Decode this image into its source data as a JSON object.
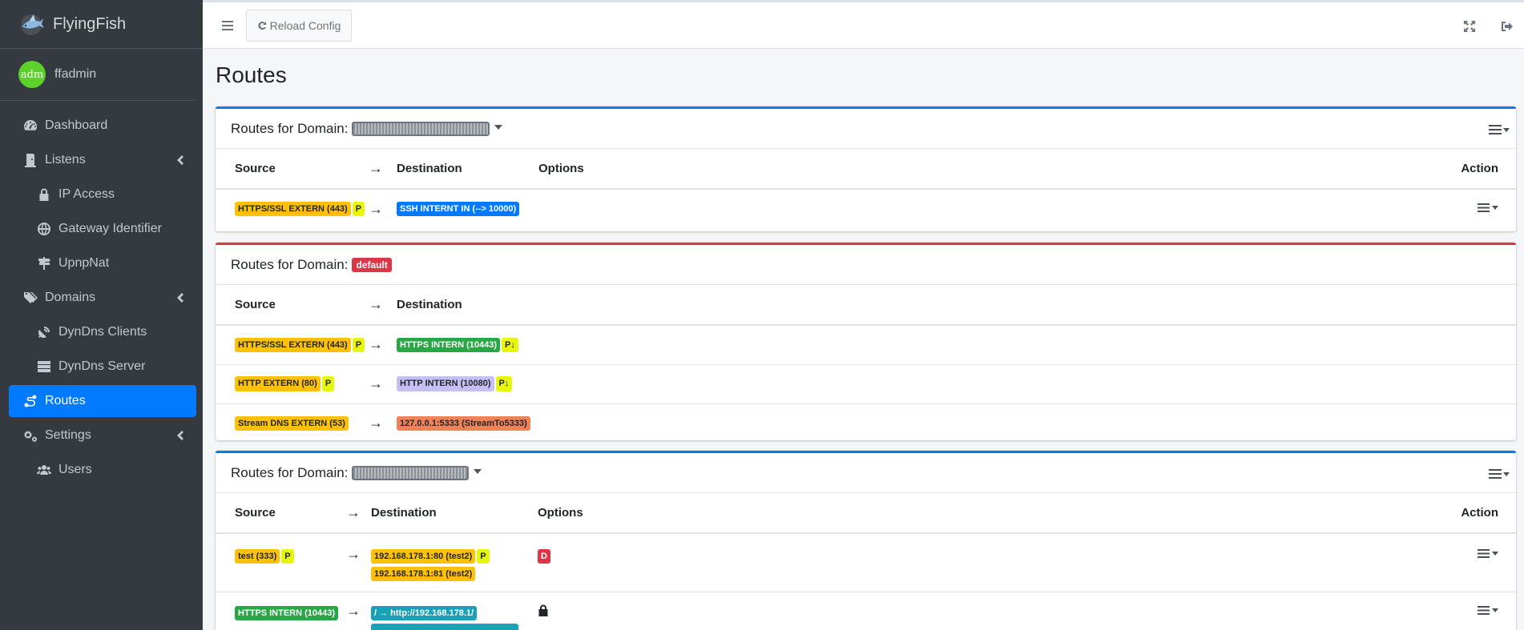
{
  "brand": {
    "name": "FlyingFish"
  },
  "user": {
    "avatar_text": "adm",
    "name": "ffadmin"
  },
  "sidebar": {
    "items": [
      {
        "label": "Dashboard",
        "icon": "tachometer-icon"
      },
      {
        "label": "Listens",
        "icon": "door-icon"
      },
      {
        "label": "IP Access",
        "icon": "lock-icon"
      },
      {
        "label": "Gateway Identifier",
        "icon": "globe-icon"
      },
      {
        "label": "UpnpNat",
        "icon": "signpost-icon"
      },
      {
        "label": "Domains",
        "icon": "tags-icon"
      },
      {
        "label": "DynDns Clients",
        "icon": "satellite-dish-icon"
      },
      {
        "label": "DynDns Server",
        "icon": "server-icon"
      },
      {
        "label": "Routes",
        "icon": "route-icon"
      },
      {
        "label": "Settings",
        "icon": "cogs-icon"
      },
      {
        "label": "Users",
        "icon": "users-icon"
      }
    ]
  },
  "toolbar": {
    "reload_label": "Reload Config"
  },
  "page": {
    "title": "Routes"
  },
  "cards": [
    {
      "header_prefix": "Routes for Domain:",
      "columns": {
        "source": "Source",
        "arrow": "→",
        "destination": "Destination",
        "options": "Options",
        "action": "Action"
      },
      "rows": [
        {
          "source": "HTTPS/SSL EXTERN (443)",
          "source_flag": "P",
          "arrow": "→",
          "destination": "SSH INTERNT IN (--> 10000)"
        }
      ]
    },
    {
      "header_prefix": "Routes for Domain:",
      "domain_badge": "default",
      "columns": {
        "source": "Source",
        "arrow": "→",
        "destination": "Destination"
      },
      "rows": [
        {
          "source": "HTTPS/SSL EXTERN (443)",
          "source_flag": "P",
          "arrow": "→",
          "destination": "HTTPS INTERN (10443)",
          "dest_flag": "P↓"
        },
        {
          "source": "HTTP EXTERN (80)",
          "source_flag": "P",
          "arrow": "→",
          "destination": "HTTP INTERN (10080)",
          "dest_flag": "P↓"
        },
        {
          "source": "Stream DNS EXTERN (53)",
          "arrow": "→",
          "destination": "127.0.0.1:5333 (StreamTo5333)"
        }
      ]
    },
    {
      "header_prefix": "Routes for Domain:",
      "columns": {
        "source": "Source",
        "arrow": "→",
        "destination": "Destination",
        "options": "Options",
        "action": "Action"
      },
      "rows": [
        {
          "source": "test (333)",
          "source_flag": "P",
          "arrow": "→",
          "destination": "192.168.178.1:80 (test2)",
          "dest_flag": "P",
          "destination2": "192.168.178.1:81 (test2)",
          "option": "D"
        },
        {
          "source": "HTTPS INTERN (10443)",
          "arrow": "→",
          "destination": "/ → http://192.168.178.1/"
        }
      ]
    }
  ],
  "colors": {
    "accent": "#007bff",
    "danger": "#dc3545",
    "sidebar": "#343a40"
  }
}
